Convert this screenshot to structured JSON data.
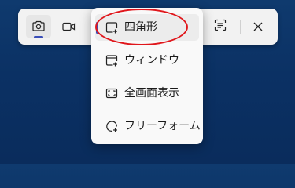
{
  "toolbar": {
    "buttons": [
      {
        "name": "camera-icon",
        "selected": true
      },
      {
        "name": "video-icon",
        "selected": false
      },
      {
        "name": "text-actions-icon",
        "selected": false
      },
      {
        "name": "close-icon",
        "selected": false
      }
    ]
  },
  "menu": {
    "items": [
      {
        "label": "四角形",
        "icon": "rectangle-snip-icon",
        "selected": true
      },
      {
        "label": "ウィンドウ",
        "icon": "window-snip-icon",
        "selected": false
      },
      {
        "label": "全画面表示",
        "icon": "fullscreen-snip-icon",
        "selected": false
      },
      {
        "label": "フリーフォーム",
        "icon": "freeform-snip-icon",
        "selected": false
      }
    ]
  },
  "colors": {
    "accent": "#3b4fb8",
    "annotation": "#e0161b"
  }
}
